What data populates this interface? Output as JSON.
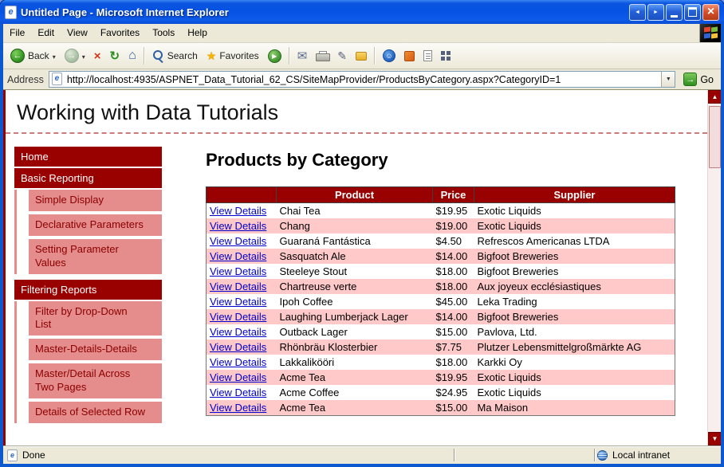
{
  "colors": {
    "accent": "#990000",
    "submenu_bg": "#e58c8c",
    "submenu_text": "#8b0000",
    "alt_row": "#ffc9c9",
    "link": "#0000cc",
    "dashed": "#cc7a7a"
  },
  "window": {
    "title": "Untitled Page - Microsoft Internet Explorer"
  },
  "menubar": {
    "items": [
      "File",
      "Edit",
      "View",
      "Favorites",
      "Tools",
      "Help"
    ]
  },
  "toolbar": {
    "back_label": "Back",
    "search_label": "Search",
    "favorites_label": "Favorites"
  },
  "addressbar": {
    "label": "Address",
    "url": "http://localhost:4935/ASPNET_Data_Tutorial_62_CS/SiteMapProvider/ProductsByCategory.aspx?CategoryID=1",
    "go_label": "Go"
  },
  "statusbar": {
    "left": "Done",
    "right": "Local intranet"
  },
  "page": {
    "site_header": "Working with Data Tutorials",
    "heading": "Products by Category",
    "sidebar": [
      {
        "label": "Home",
        "level": 0
      },
      {
        "label": "Basic Reporting",
        "level": 0
      },
      {
        "label": "Simple Display",
        "level": 1
      },
      {
        "label": "Declarative Parameters",
        "level": 1
      },
      {
        "label": "Setting Parameter Values",
        "level": 1
      },
      {
        "label": "Filtering Reports",
        "level": 0
      },
      {
        "label": "Filter by Drop-Down List",
        "level": 1
      },
      {
        "label": "Master-Details-Details",
        "level": 1
      },
      {
        "label": "Master/Detail Across Two Pages",
        "level": 1
      },
      {
        "label": "Details of Selected Row",
        "level": 1
      }
    ],
    "table": {
      "headers": {
        "product": "Product",
        "price": "Price",
        "supplier": "Supplier"
      },
      "link_label": "View Details",
      "rows": [
        {
          "product": "Chai Tea",
          "price": "$19.95",
          "supplier": "Exotic Liquids"
        },
        {
          "product": "Chang",
          "price": "$19.00",
          "supplier": "Exotic Liquids"
        },
        {
          "product": "Guaraná Fantástica",
          "price": "$4.50",
          "supplier": "Refrescos Americanas LTDA"
        },
        {
          "product": "Sasquatch Ale",
          "price": "$14.00",
          "supplier": "Bigfoot Breweries"
        },
        {
          "product": "Steeleye Stout",
          "price": "$18.00",
          "supplier": "Bigfoot Breweries"
        },
        {
          "product": "Chartreuse verte",
          "price": "$18.00",
          "supplier": "Aux joyeux ecclésiastiques"
        },
        {
          "product": "Ipoh Coffee",
          "price": "$45.00",
          "supplier": "Leka Trading"
        },
        {
          "product": "Laughing Lumberjack Lager",
          "price": "$14.00",
          "supplier": "Bigfoot Breweries"
        },
        {
          "product": "Outback Lager",
          "price": "$15.00",
          "supplier": "Pavlova, Ltd."
        },
        {
          "product": "Rhönbräu Klosterbier",
          "price": "$7.75",
          "supplier": "Plutzer Lebensmittelgroßmärkte AG"
        },
        {
          "product": "Lakkalikööri",
          "price": "$18.00",
          "supplier": "Karkki Oy"
        },
        {
          "product": "Acme Tea",
          "price": "$19.95",
          "supplier": "Exotic Liquids"
        },
        {
          "product": "Acme Coffee",
          "price": "$24.95",
          "supplier": "Exotic Liquids"
        },
        {
          "product": "Acme Tea",
          "price": "$15.00",
          "supplier": "Ma Maison"
        }
      ]
    }
  }
}
